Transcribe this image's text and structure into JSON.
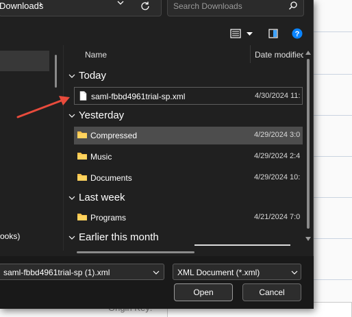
{
  "window": {
    "breadcrumb": "Downloads",
    "breadcrumb_separator": "›",
    "search_placeholder": "Search Downloads",
    "accent_color": "#0067c0"
  },
  "toolbar": {
    "icons": [
      "view-list-icon",
      "view-options-caret-icon",
      "preview-pane-icon",
      "help-icon"
    ]
  },
  "nav": {
    "partial_item_label": "ooks)"
  },
  "columns": {
    "name": "Name",
    "date": "Date modified"
  },
  "groups": [
    {
      "label": "Today",
      "items": [
        {
          "name": "saml-fbbd4961trial-sp.xml",
          "date": "4/30/2024 11:",
          "icon": "xml-file-icon",
          "state": "focused"
        }
      ]
    },
    {
      "label": "Yesterday",
      "items": [
        {
          "name": "Compressed",
          "date": "4/29/2024 3:0",
          "icon": "folder-icon",
          "state": "hover"
        },
        {
          "name": "Music",
          "date": "4/29/2024 2:4",
          "icon": "folder-icon",
          "state": ""
        },
        {
          "name": "Documents",
          "date": "4/29/2024 10:",
          "icon": "folder-icon",
          "state": ""
        }
      ]
    },
    {
      "label": "Last week",
      "items": [
        {
          "name": "Programs",
          "date": "4/21/2024 7:0",
          "icon": "folder-icon",
          "state": ""
        }
      ]
    },
    {
      "label": "Earlier this month",
      "items": []
    }
  ],
  "footer": {
    "filename_value": "saml-fbbd4961trial-sp (1).xml",
    "filetype_value": "XML Document (*.xml)",
    "open_label": "Open",
    "cancel_label": "Cancel"
  },
  "background_page": {
    "field_label": "Origin Key:"
  },
  "annotation": {
    "arrow_color": "#e84b3c"
  }
}
